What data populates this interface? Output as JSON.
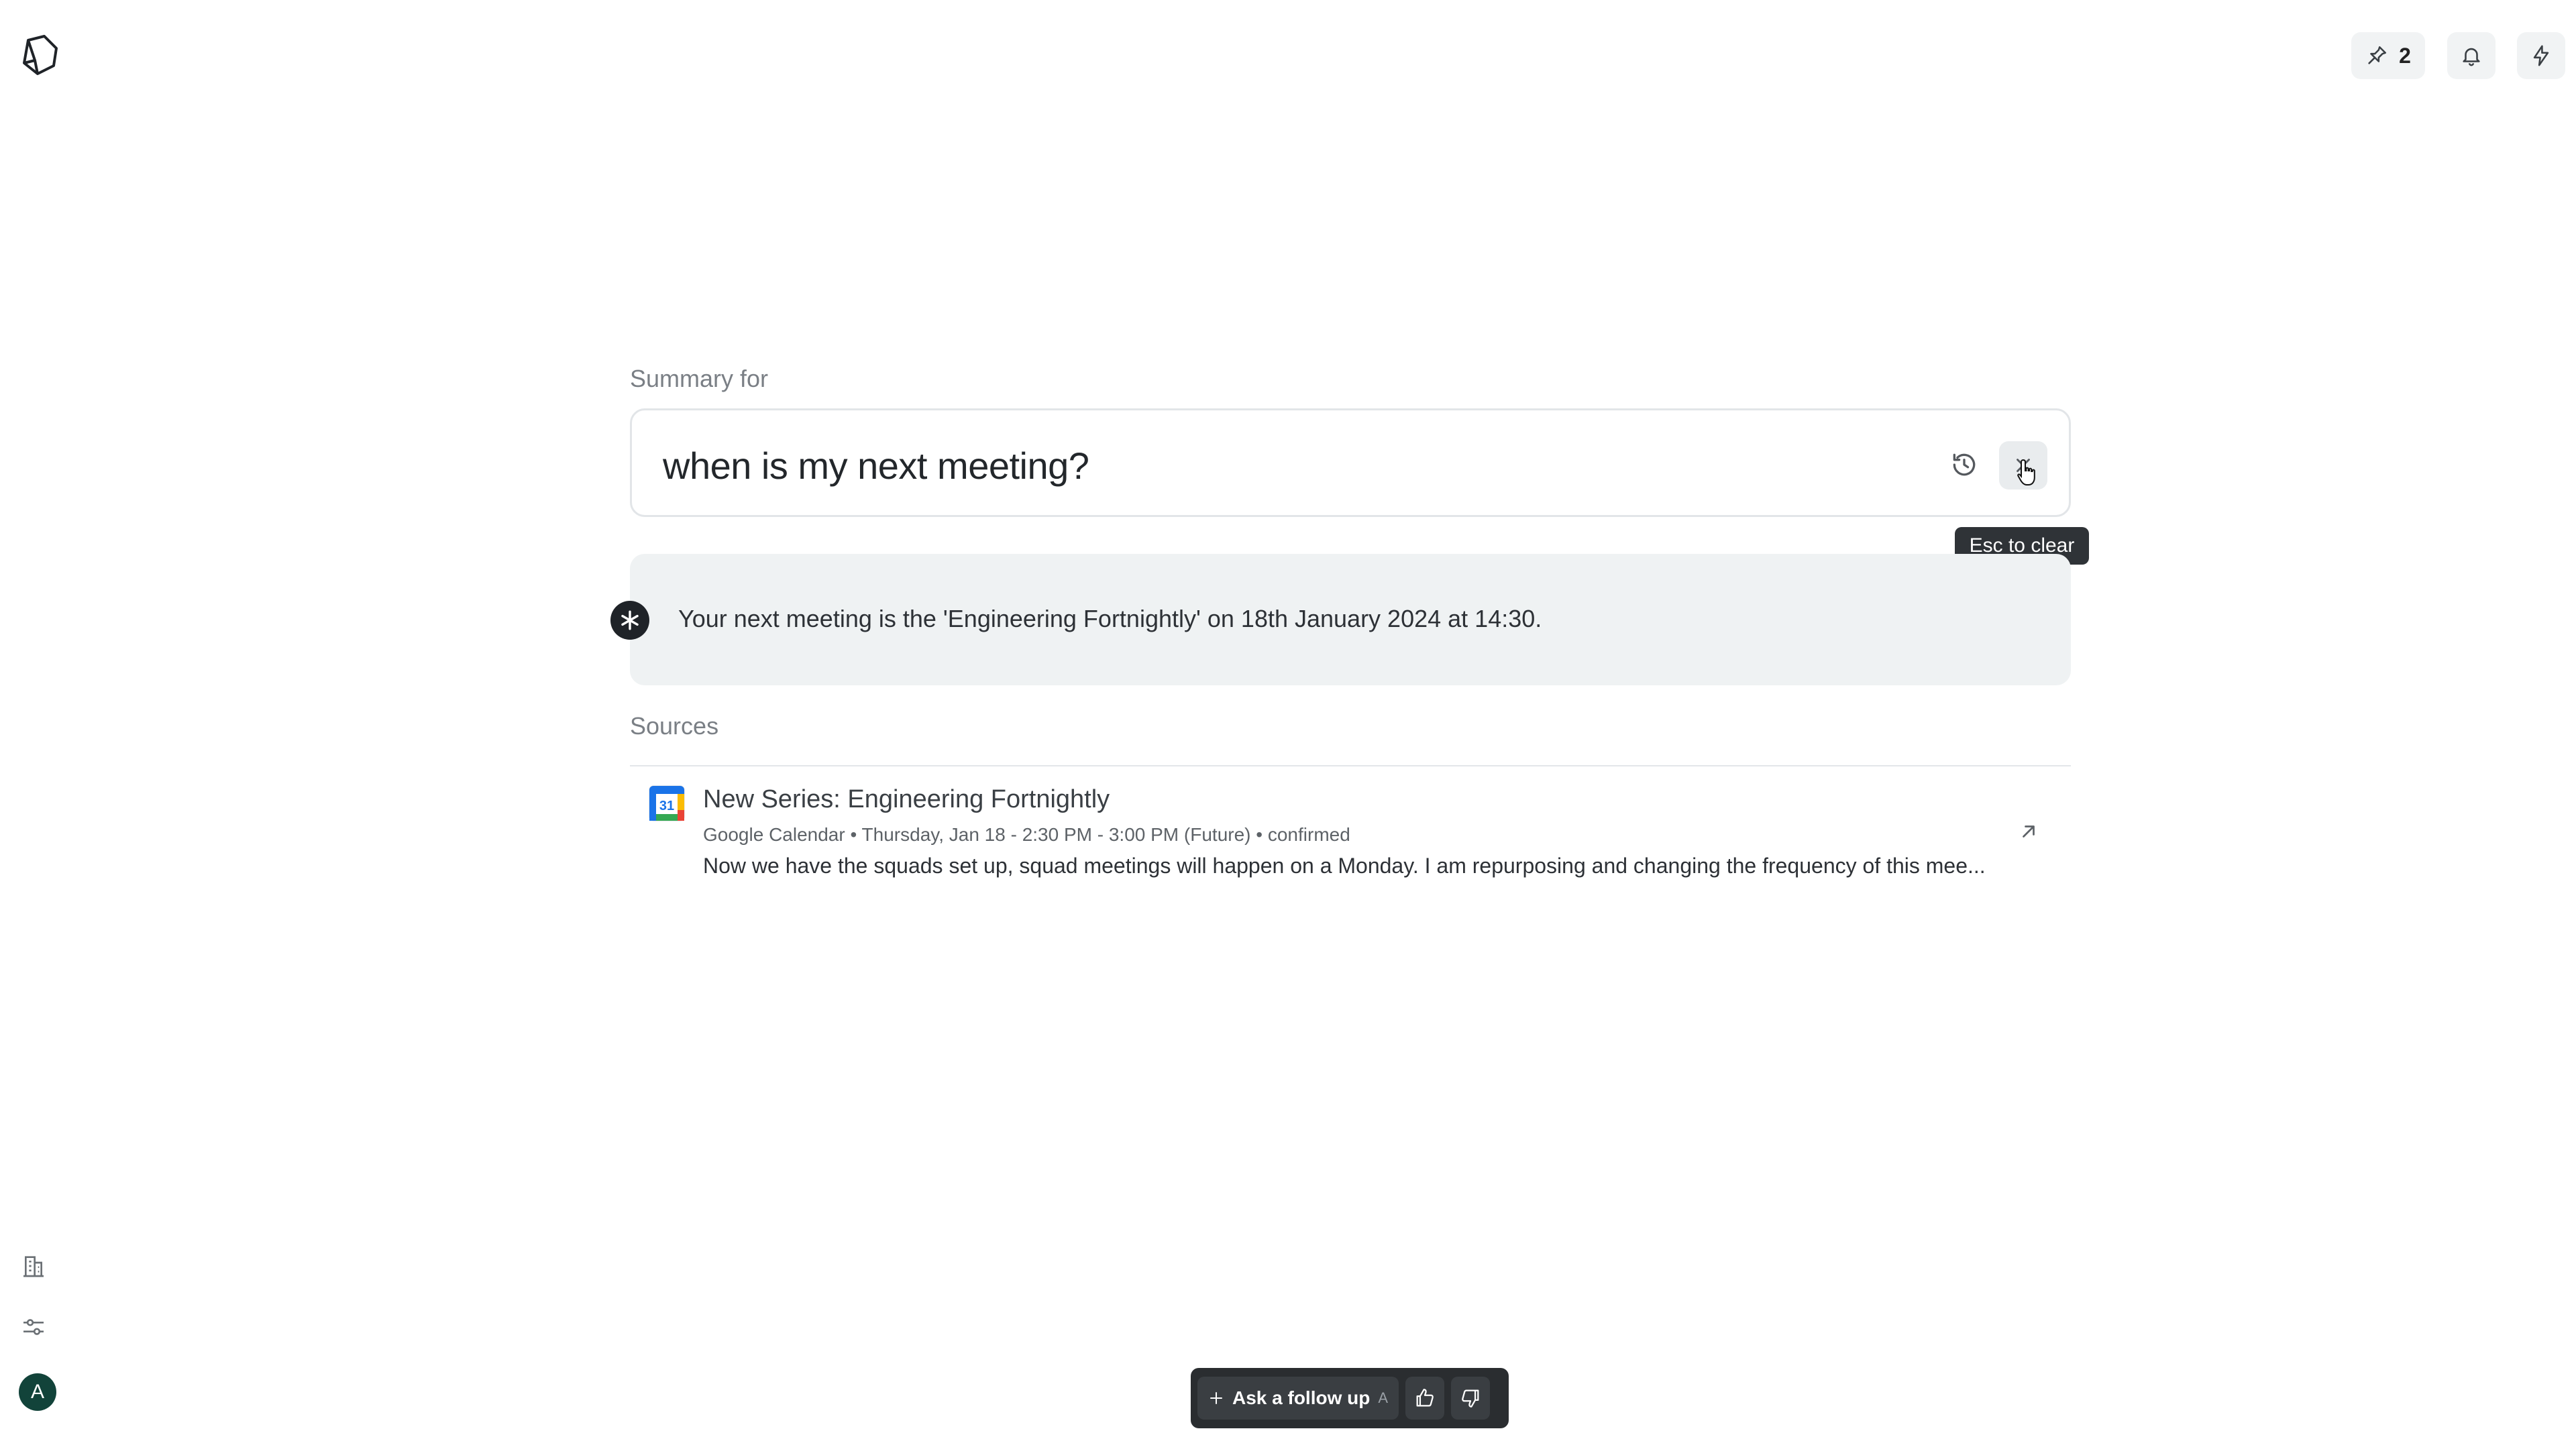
{
  "header": {
    "pinned_count": "2"
  },
  "search": {
    "label": "Summary for",
    "query": "when is my next meeting?",
    "tooltip": "Esc to clear"
  },
  "answer": {
    "text": "Your next meeting is the 'Engineering Fortnightly' on 18th January 2024 at 14:30."
  },
  "sources": {
    "label": "Sources",
    "items": [
      {
        "icon_day": "31",
        "title": "New Series: Engineering Fortnightly",
        "meta": "Google Calendar • Thursday, Jan 18 - 2:30 PM - 3:00 PM (Future) • confirmed",
        "snippet": "Now we have the squads set up, squad meetings will happen on a Monday. I am repurposing and changing the frequency of this mee..."
      }
    ]
  },
  "footer": {
    "follow_up_label": "Ask a follow up",
    "follow_up_shortcut": "A"
  },
  "user": {
    "avatar_initial": "A"
  }
}
